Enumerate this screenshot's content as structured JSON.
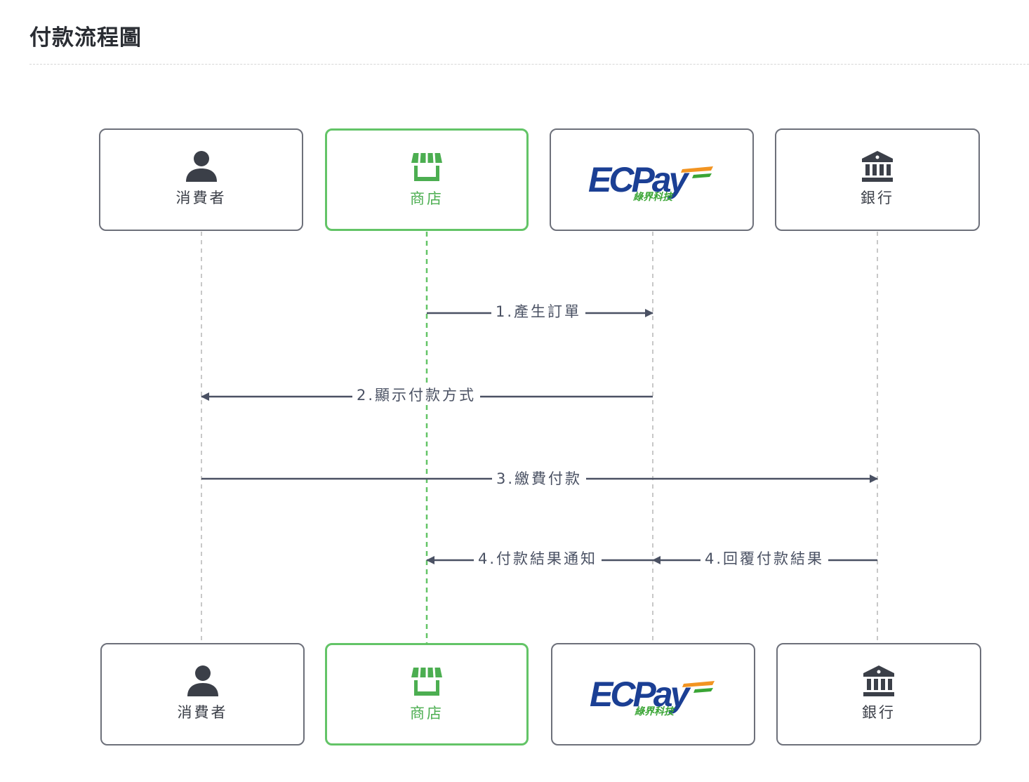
{
  "page": {
    "title": "付款流程圖"
  },
  "actors": [
    {
      "id": "consumer",
      "label": "消費者",
      "icon": "user-icon"
    },
    {
      "id": "store",
      "label": "商店",
      "icon": "storefront-icon"
    },
    {
      "id": "ecpay",
      "logo_text": "ECPay",
      "logo_subtext": "綠界科技",
      "icon": "ecpay-logo"
    },
    {
      "id": "bank",
      "label": "銀行",
      "icon": "bank-icon"
    }
  ],
  "messages": [
    {
      "label": "1.產生訂單",
      "from": "store",
      "to": "ecpay"
    },
    {
      "label": "2.顯示付款方式",
      "from": "ecpay",
      "to": "consumer"
    },
    {
      "label": "3.繳費付款",
      "from": "consumer",
      "to": "bank"
    },
    {
      "label": "4.付款結果通知",
      "from": "ecpay",
      "to": "store"
    },
    {
      "label": "4.回覆付款結果",
      "from": "bank",
      "to": "ecpay"
    }
  ],
  "colors": {
    "store_accent": "#63c467",
    "box_border": "#6d707a",
    "arrow": "#4a5163",
    "lifeline": "#c8c8c8",
    "icon": "#3b3f48",
    "ecpay_blue": "#1b3f94",
    "ecpay_green": "#3aa535",
    "ecpay_orange": "#f29421"
  }
}
